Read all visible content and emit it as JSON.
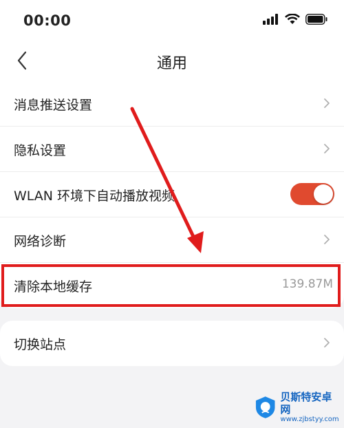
{
  "status_bar": {
    "time": "00:00"
  },
  "nav": {
    "title": "通用"
  },
  "settings": [
    {
      "label": "消息推送设置"
    },
    {
      "label": "隐私设置"
    },
    {
      "label": "WLAN 环境下自动播放视频",
      "toggle_on": true
    },
    {
      "label": "网络诊断"
    },
    {
      "label": "清除本地缓存",
      "value": "139.87M"
    }
  ],
  "settings2": [
    {
      "label": "切换站点"
    }
  ],
  "colors": {
    "toggle_on": "#e04a2f",
    "highlight": "#e01c1c",
    "chevron": "#b0b0b0"
  },
  "watermark": {
    "main": "贝斯特安卓网",
    "sub": "www.zjbstyy.com"
  }
}
